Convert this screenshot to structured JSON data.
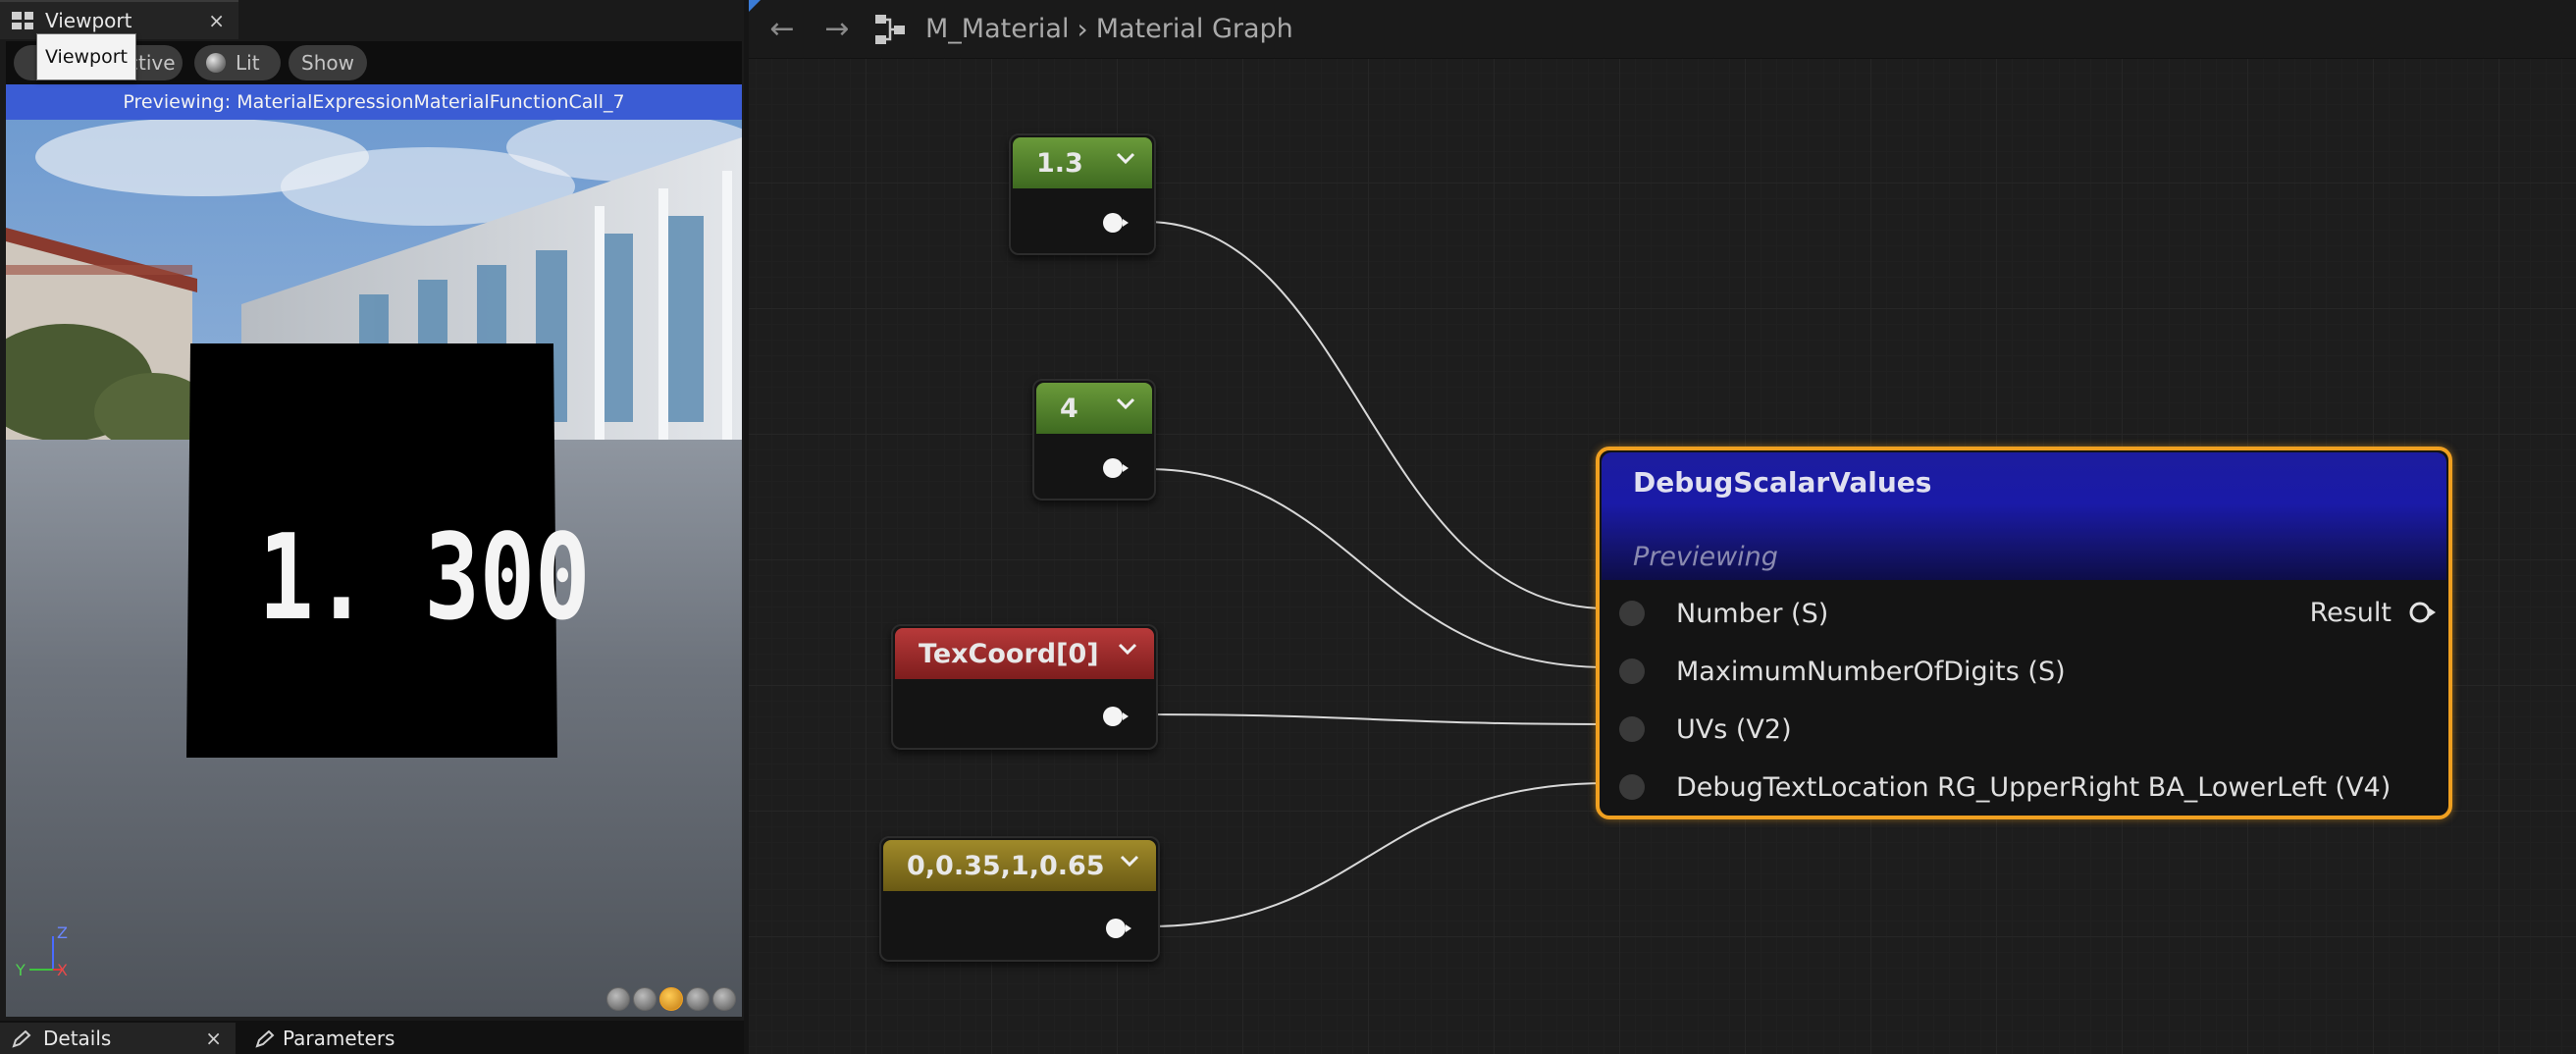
{
  "left_panel": {
    "viewport_tab": {
      "label": "Viewport",
      "close": "×"
    },
    "toolbar": {
      "perspective_label": "ctive",
      "lit_label": "Lit",
      "show_label": "Show"
    },
    "tooltip": "Viewport",
    "preview_banner": "Previewing: MaterialExpressionMaterialFunctionCall_7",
    "scene": {
      "cube_text": "1. 300"
    },
    "axis": {
      "z": "Z",
      "y": "Y",
      "x": "X"
    },
    "view_modes": [
      "cylinder",
      "sphere",
      "plane",
      "cube",
      "custom"
    ],
    "active_view_mode": "plane",
    "bottom_tabs": {
      "details": "Details",
      "details_close": "×",
      "parameters": "Parameters"
    }
  },
  "graph": {
    "breadcrumb": {
      "material": "M_Material",
      "separator": "›",
      "graph": "Material Graph"
    },
    "nodes": {
      "constant_a": {
        "title": "1.3"
      },
      "constant_b": {
        "title": "4"
      },
      "texcoord": {
        "title": "TexCoord[0]"
      },
      "vector4": {
        "title": "0,0.35,1,0.65"
      },
      "debug": {
        "title": "DebugScalarValues",
        "subtitle": "Previewing",
        "inputs": [
          "Number (S)",
          "MaximumNumberOfDigits (S)",
          "UVs (V2)",
          "DebugTextLocation RG_UpperRight BA_LowerLeft (V4)"
        ],
        "output": "Result"
      }
    },
    "colors": {
      "selection": "#f0a020",
      "constant_header": "#5a8a30",
      "texcoord_header": "#a02a2a",
      "vector_header": "#8a7a22",
      "function_header": "#1a1aa8"
    }
  }
}
